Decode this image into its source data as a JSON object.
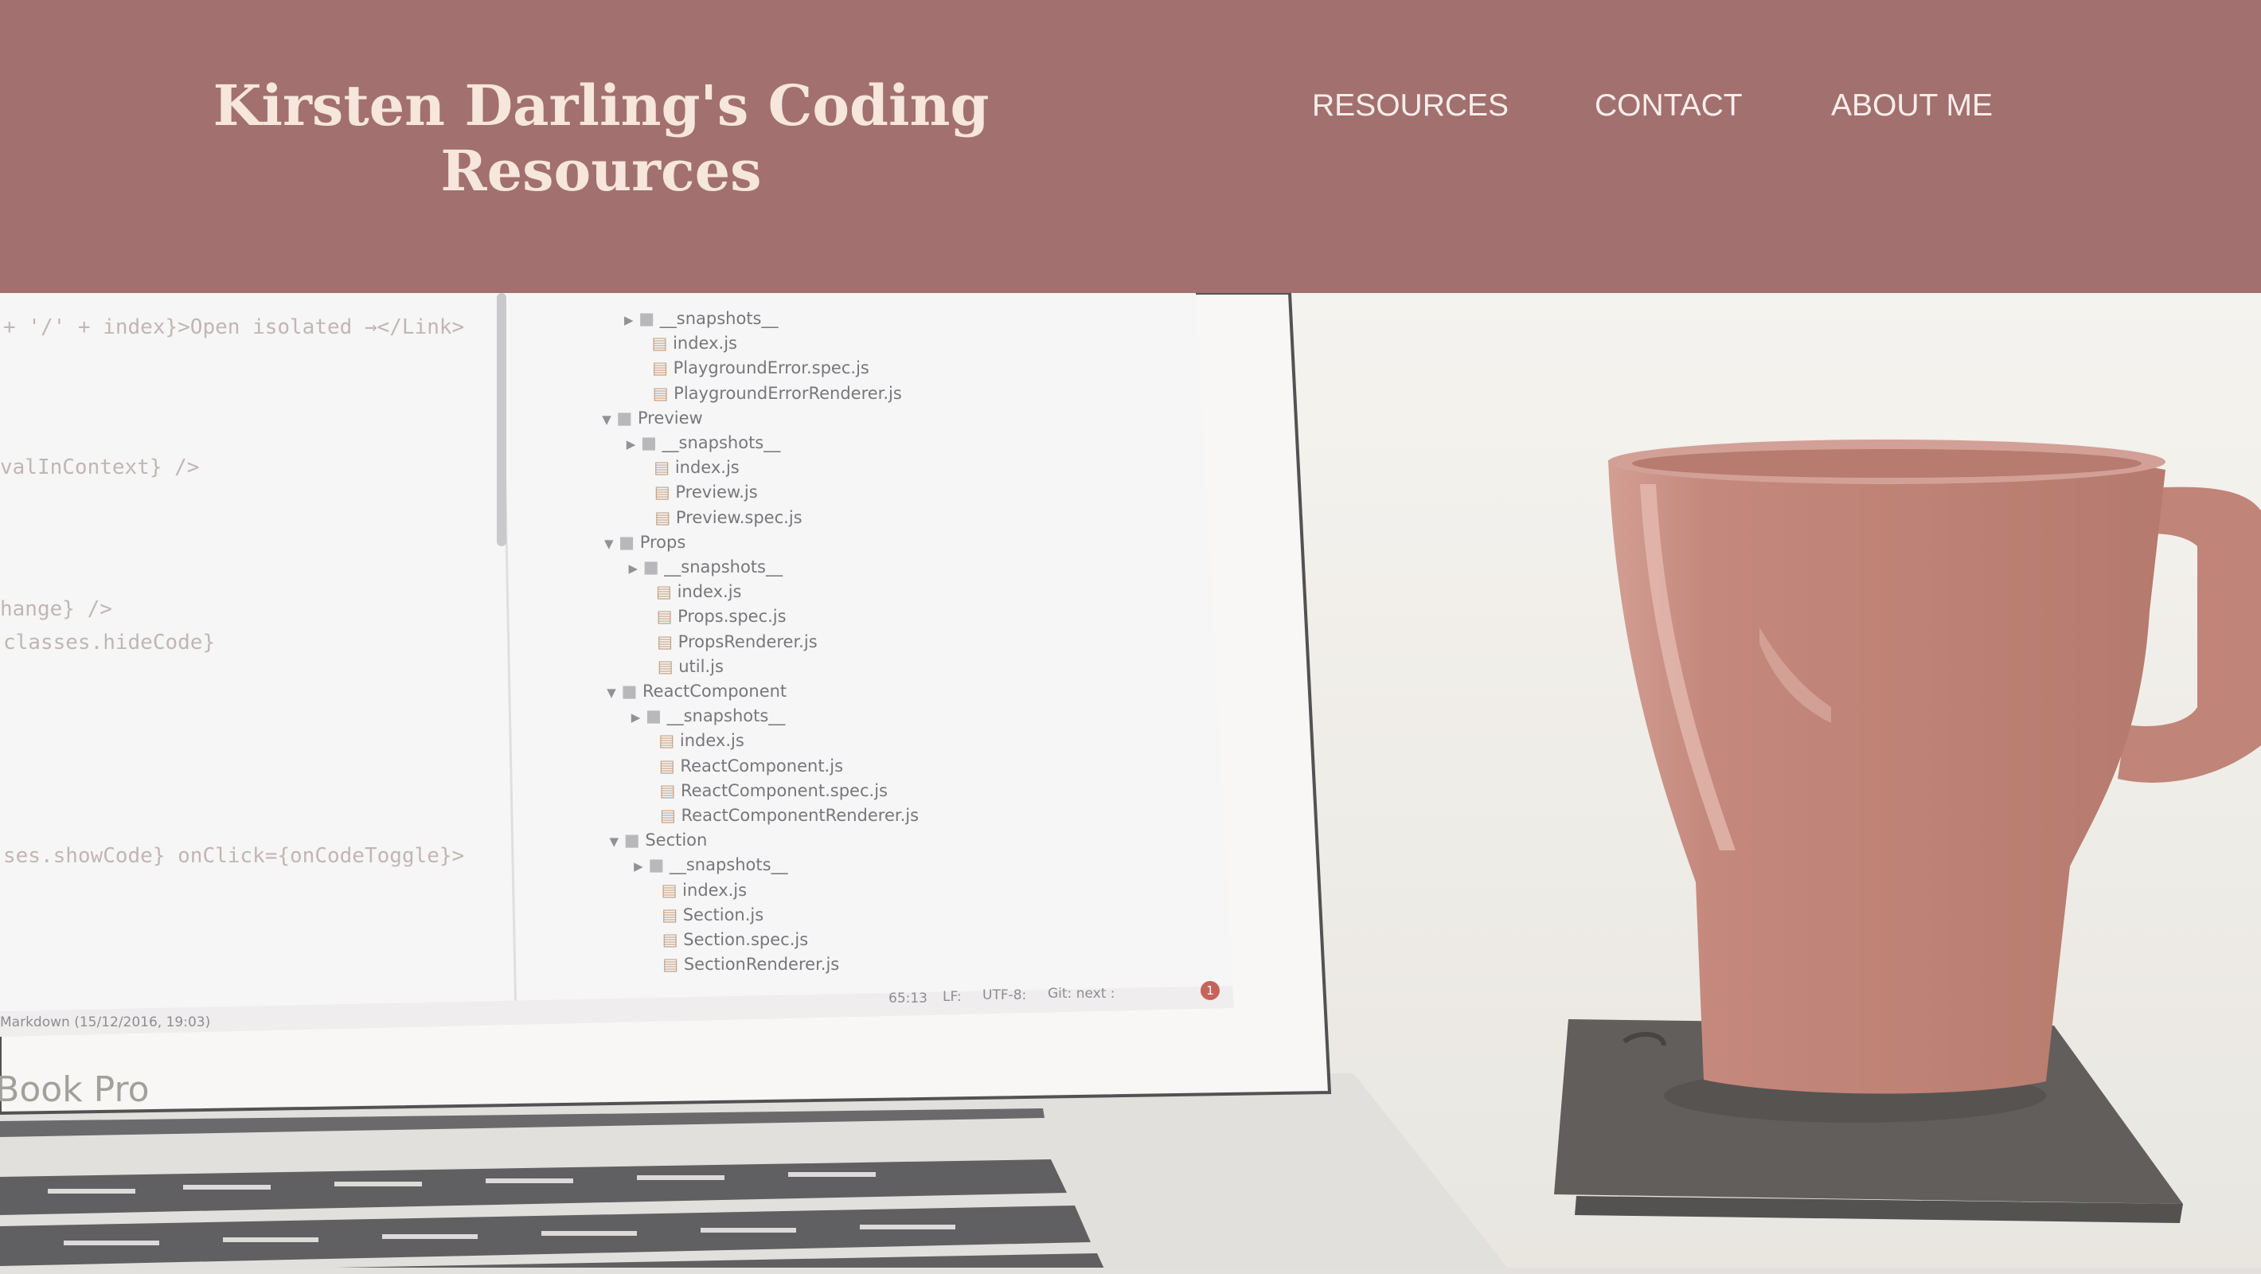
{
  "header": {
    "title_line1": "Kirsten Darling's Coding",
    "title_line2": "Resources",
    "nav": [
      "RESOURCES",
      "CONTACT",
      "ABOUT ME"
    ]
  },
  "colors": {
    "header_bg": "#a2706e",
    "title": "#f6e6dc",
    "nav_text": "#f7eeeb",
    "mug": "#b86e62"
  },
  "hero": {
    "code_lines": [
      "+ '/' + index}>Open isolated →</Link>",
      "valInContext} />",
      "hange} />",
      "classes.hideCode}",
      "ses.showCode} onClick={onCodeToggle}>"
    ],
    "file_tree": [
      {
        "label": "__snapshots__",
        "kind": "folder-collapsed"
      },
      {
        "label": "index.js",
        "kind": "file"
      },
      {
        "label": "PlaygroundError.spec.js",
        "kind": "file"
      },
      {
        "label": "PlaygroundErrorRenderer.js",
        "kind": "file"
      },
      {
        "label": "Preview",
        "kind": "folder-open"
      },
      {
        "label": "__snapshots__",
        "kind": "folder-collapsed"
      },
      {
        "label": "index.js",
        "kind": "file"
      },
      {
        "label": "Preview.js",
        "kind": "file"
      },
      {
        "label": "Preview.spec.js",
        "kind": "file"
      },
      {
        "label": "Props",
        "kind": "folder-open"
      },
      {
        "label": "__snapshots__",
        "kind": "folder-collapsed"
      },
      {
        "label": "index.js",
        "kind": "file"
      },
      {
        "label": "Props.spec.js",
        "kind": "file"
      },
      {
        "label": "PropsRenderer.js",
        "kind": "file"
      },
      {
        "label": "util.js",
        "kind": "file"
      },
      {
        "label": "ReactComponent",
        "kind": "folder-open"
      },
      {
        "label": "__snapshots__",
        "kind": "folder-collapsed"
      },
      {
        "label": "index.js",
        "kind": "file"
      },
      {
        "label": "ReactComponent.js",
        "kind": "file"
      },
      {
        "label": "ReactComponent.spec.js",
        "kind": "file"
      },
      {
        "label": "ReactComponentRenderer.js",
        "kind": "file"
      },
      {
        "label": "Section",
        "kind": "folder-open"
      },
      {
        "label": "__snapshots__",
        "kind": "folder-collapsed"
      },
      {
        "label": "index.js",
        "kind": "file"
      },
      {
        "label": "Section.js",
        "kind": "file"
      },
      {
        "label": "Section.spec.js",
        "kind": "file"
      },
      {
        "label": "SectionRenderer.js",
        "kind": "file"
      }
    ],
    "status_left": "Markdown (15/12/2016, 19:03)",
    "status_right": [
      "65:13",
      "LF:",
      "UTF-8:",
      "Git: next :"
    ],
    "status_badge": "1",
    "laptop_label": "cBook Pro"
  }
}
